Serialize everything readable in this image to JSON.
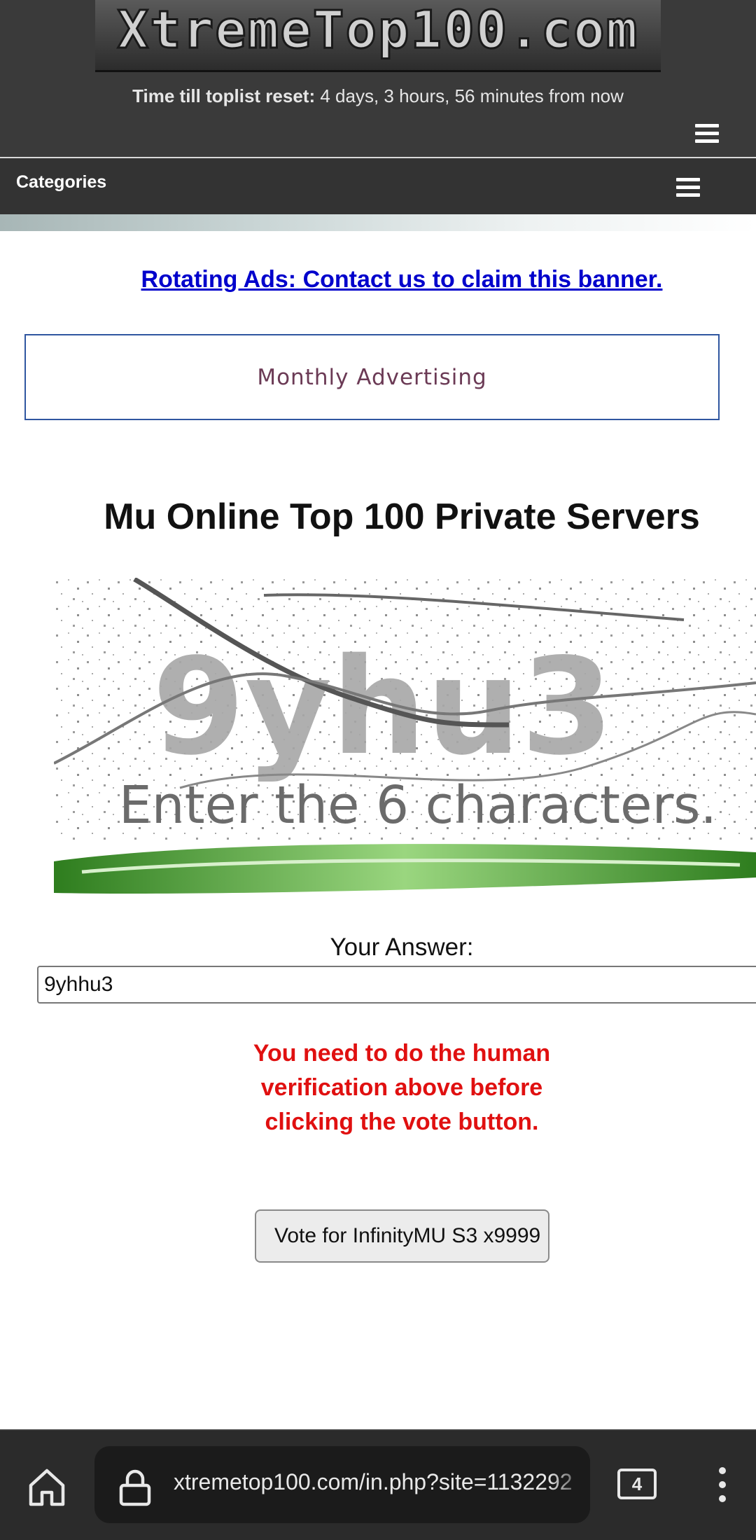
{
  "header": {
    "logo_text": "XtremeTop100.com",
    "reset_label": "Time till toplist reset:",
    "reset_value": "4 days, 3 hours, 56 minutes from now",
    "menu_icon": "hamburger-menu-icon"
  },
  "categories": {
    "label": "Categories",
    "menu_icon": "hamburger-menu-icon"
  },
  "ads": {
    "rotating_link": "Rotating Ads: Contact us to claim this banner.",
    "monthly_label": "Monthly Advertising"
  },
  "main": {
    "title": "Mu Online Top 100 Private Servers",
    "captcha": {
      "code": "9yhu3",
      "instruction": "Enter the 6 characters."
    },
    "answer_label": "Your Answer:",
    "answer_value": "9yhhu3",
    "warning": "You need to do the human verification above before clicking the vote button.",
    "vote_button": "Vote for InfinityMU S3 x9999"
  },
  "browser": {
    "url": "xtremetop100.com/in.php?site=1132292",
    "tab_count": "4",
    "colors": {
      "bar": "#2b2b2b",
      "pill": "#1b1b1b"
    }
  },
  "colors": {
    "header_bg": "#3a3a3a",
    "category_bg": "#333333",
    "link": "#0000cc",
    "warning": "#e01010"
  }
}
